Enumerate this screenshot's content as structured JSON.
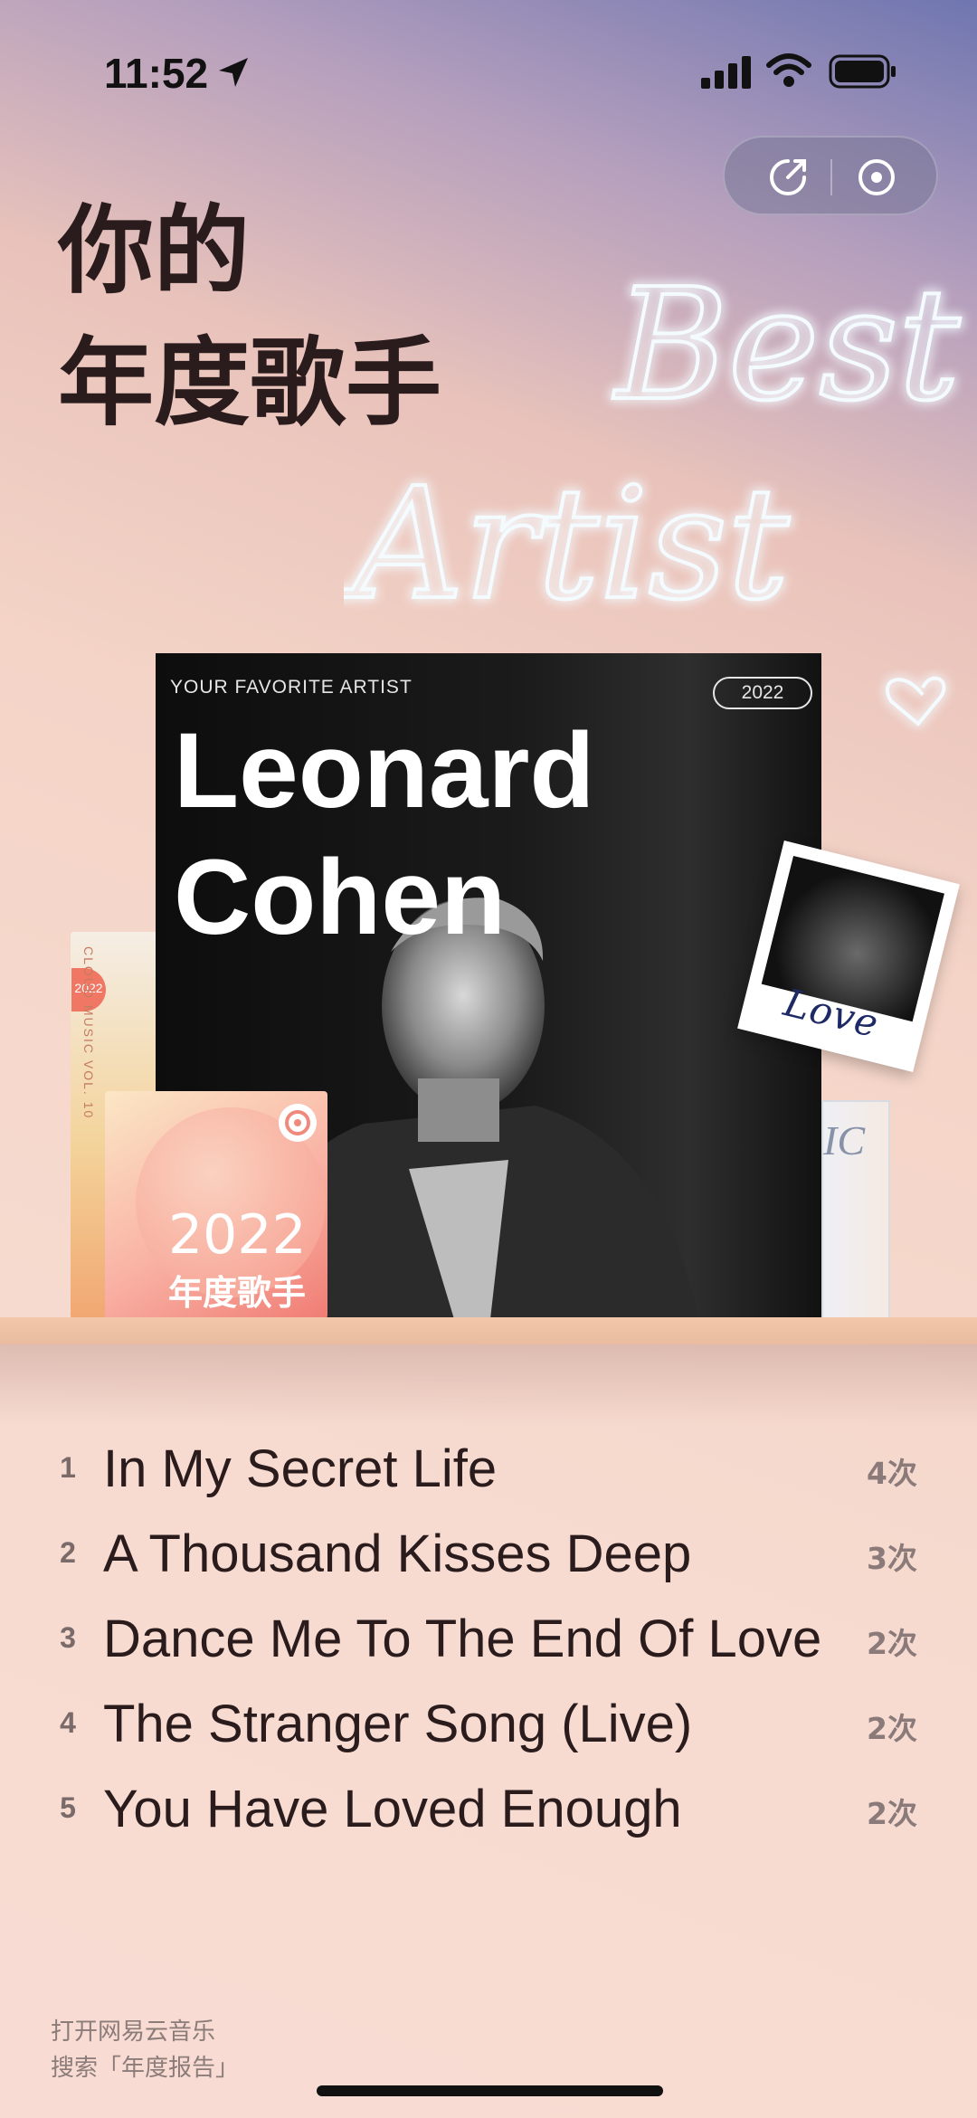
{
  "status_bar": {
    "time": "11:52"
  },
  "headline": {
    "line1": "你的",
    "line2": "年度歌手"
  },
  "neon": {
    "line1": "Best",
    "line2": "Artist"
  },
  "album": {
    "subtitle": "YOUR FAVORITE ARTIST",
    "year": "2022",
    "artist_line1": "Leonard",
    "artist_line2": "Cohen"
  },
  "front_album": {
    "year": "2022",
    "label": "年度歌手"
  },
  "left_album": {
    "badge": "2022",
    "spine_text": "CLOUD MUSIC VOL. 10"
  },
  "right_album": {
    "text": "IC"
  },
  "polaroid": {
    "caption": "Love"
  },
  "songs": [
    {
      "rank": "1",
      "title": "In My Secret Life",
      "count": "4次"
    },
    {
      "rank": "2",
      "title": "A Thousand Kisses Deep",
      "count": "3次"
    },
    {
      "rank": "3",
      "title": "Dance Me To The End Of Love",
      "count": "2次"
    },
    {
      "rank": "4",
      "title": "The Stranger Song (Live)",
      "count": "2次"
    },
    {
      "rank": "5",
      "title": "You Have Loved Enough",
      "count": "2次"
    }
  ],
  "footer": {
    "line1": "打开网易云音乐",
    "line2": "搜索「年度报告」"
  }
}
